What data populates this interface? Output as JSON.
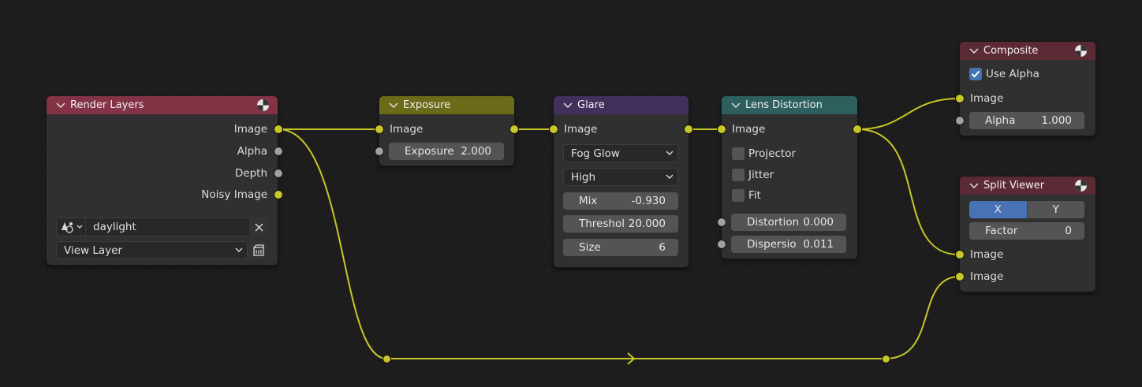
{
  "canvas": {
    "background": "#1d1d1d",
    "wire_color": "#c7c729"
  },
  "nodes": {
    "render_layers": {
      "title": "Render Layers",
      "header_color": "#843246",
      "outputs": [
        "Image",
        "Alpha",
        "Depth",
        "Noisy Image"
      ],
      "scene": "daylight",
      "layer": "View Layer"
    },
    "exposure": {
      "title": "Exposure",
      "header_color": "#6a6a19",
      "input_image": "Image",
      "exposure_label": "Exposure",
      "exposure_value": "2.000"
    },
    "glare": {
      "title": "Glare",
      "header_color": "#412f5c",
      "input_image": "Image",
      "type": "Fog Glow",
      "quality": "High",
      "mix_label": "Mix",
      "mix_value": "-0.930",
      "threshold_label": "Threshol",
      "threshold_value": "20.000",
      "size_label": "Size",
      "size_value": "6"
    },
    "lens_distortion": {
      "title": "Lens Distortion",
      "header_color": "#2d5f5f",
      "input_image": "Image",
      "projector_label": "Projector",
      "projector_checked": false,
      "jitter_label": "Jitter",
      "jitter_checked": false,
      "fit_label": "Fit",
      "fit_checked": false,
      "distortion_label": "Distortion",
      "distortion_value": "0.000",
      "dispersion_label": "Dispersio",
      "dispersion_value": "0.011"
    },
    "composite": {
      "title": "Composite",
      "header_color": "#5c2a35",
      "use_alpha_label": "Use Alpha",
      "use_alpha_checked": true,
      "input_image": "Image",
      "alpha_label": "Alpha",
      "alpha_value": "1.000"
    },
    "split_viewer": {
      "title": "Split Viewer",
      "header_color": "#5c2a35",
      "axis_x": "X",
      "axis_y": "Y",
      "active_axis": "X",
      "factor_label": "Factor",
      "factor_value": "0",
      "input_image_1": "Image",
      "input_image_2": "Image"
    }
  },
  "icons": {
    "node_output": "output-node-icon",
    "collapse": "chevron-down-icon",
    "clear": "x-icon",
    "scene_browse": "scene-browse-icon",
    "render_layer": "render-layer-icon"
  }
}
